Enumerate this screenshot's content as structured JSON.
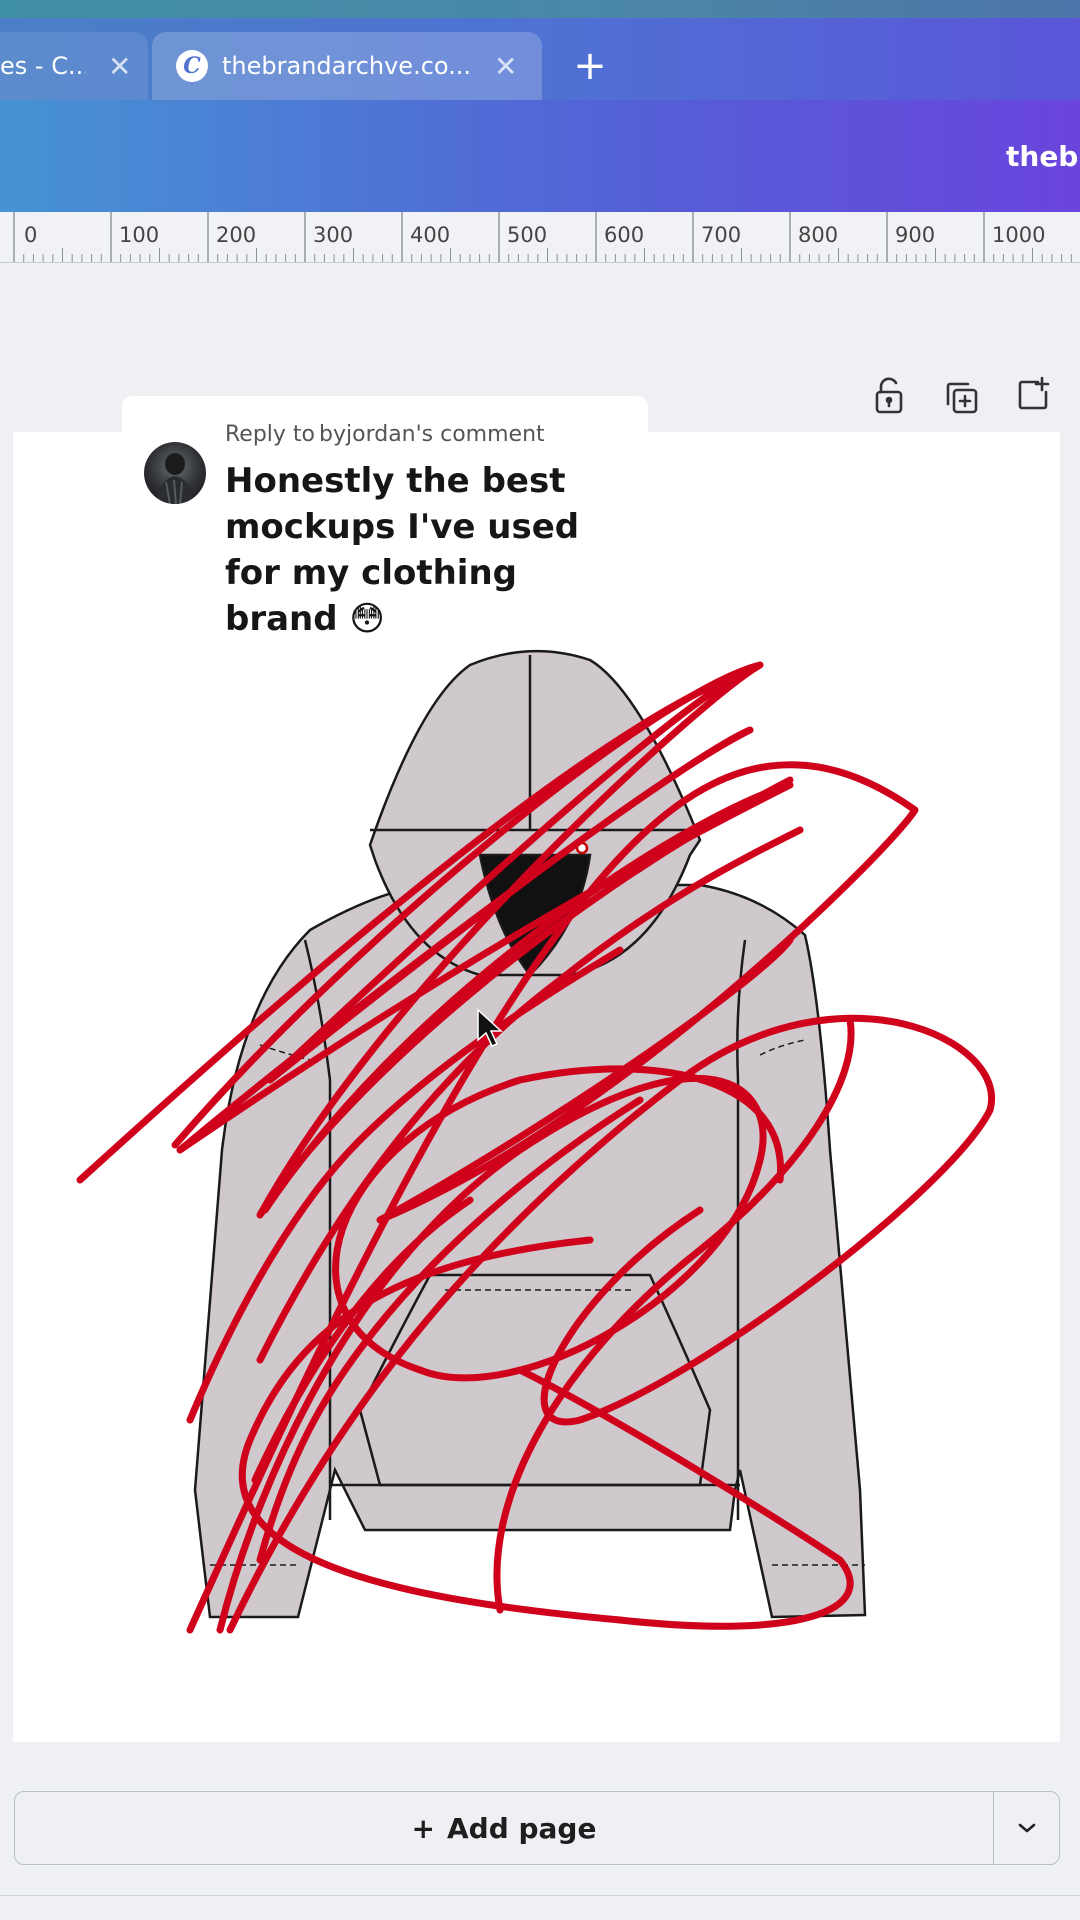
{
  "browser": {
    "tabs": [
      {
        "title": "es - C...",
        "close": "✕"
      },
      {
        "title": "thebrandarchve.co...",
        "close": "✕",
        "favicon": "C"
      }
    ],
    "new_tab": "+"
  },
  "header": {
    "brand": "thebr"
  },
  "ruler": {
    "labels": [
      "0",
      "100",
      "200",
      "300",
      "400",
      "500",
      "600",
      "700",
      "800",
      "900",
      "1000"
    ]
  },
  "page_actions": {
    "icons": [
      "unlock-icon",
      "duplicate-page-icon",
      "add-page-icon"
    ]
  },
  "comment": {
    "reply_prefix": "Reply to",
    "reply_user": "byjordan",
    "reply_suffix": "'s comment",
    "text": "Honestly the best mockups I've used for my clothing brand 😳"
  },
  "footer": {
    "add_page_plus": "+",
    "add_page_label": "Add page",
    "menu_icon": "chevron-down-icon"
  },
  "colors": {
    "scribble": "#d0021b",
    "hoodie_fill": "#cfc8cc",
    "hoodie_inner": "#111111"
  }
}
